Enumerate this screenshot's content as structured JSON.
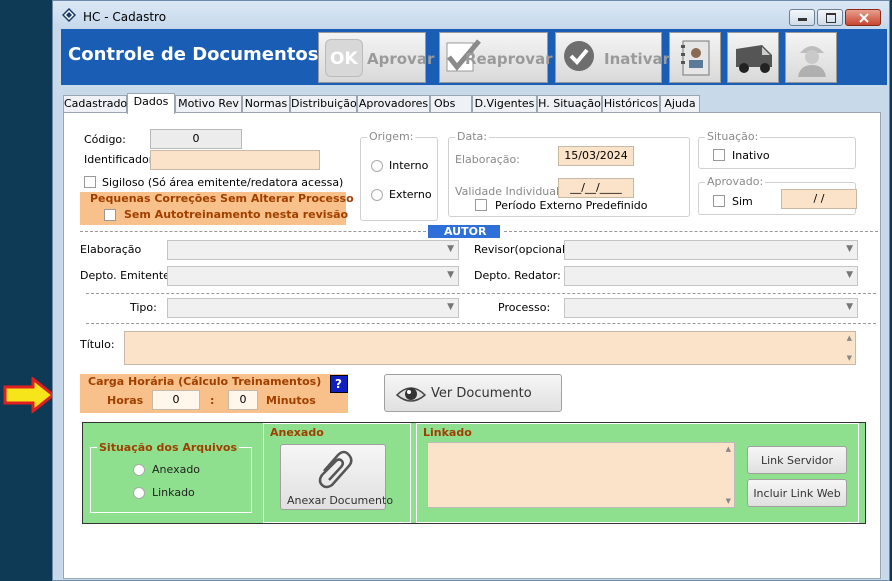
{
  "window": {
    "title": "HC - Cadastro"
  },
  "header": {
    "title": "Controle de Documentos",
    "buttons": {
      "aprovar": "Aprovar",
      "reaprovar": "Reaprovar",
      "inativar": "Inativar"
    },
    "ok_glyph": "OK"
  },
  "tabs": [
    "Cadastrado",
    "Dados",
    "Motivo Rev",
    "Normas",
    "Distribuição",
    "Aprovadores",
    "Obs",
    "D.Vigentes",
    "H. Situação",
    "Históricos",
    "Ajuda"
  ],
  "form": {
    "codigo_label": "Código:",
    "codigo_value": "0",
    "identificador_label": "Identificador:",
    "sigiloso_label": "Sigiloso (Só área emitente/redatora acessa)",
    "pequenas_title": "Pequenas Correções Sem Alterar Processo",
    "sem_autotreinamento": "Sem Autotreinamento nesta revisão",
    "origem_title": "Origem:",
    "interno": "Interno",
    "externo": "Externo",
    "data_title": "Data:",
    "elaboracao_label": "Elaboração:",
    "elaboracao_value": "15/03/2024",
    "validade_label": "Validade Individual:",
    "validade_value": "__/__/____",
    "periodo_externo": "Período Externo Predefinido",
    "situacao_title": "Situação:",
    "inativo": "Inativo",
    "aprovado_title": "Aprovado:",
    "sim": "Sim",
    "aprovado_value": "/ /",
    "autor_band": "AUTOR",
    "elaboracao_combo_label": "Elaboração",
    "revisor_label": "Revisor(opcional)",
    "depto_emitente_label": "Depto. Emitente:",
    "depto_redator_label": "Depto. Redator:",
    "tipo_label": "Tipo:",
    "processo_label": "Processo:",
    "titulo_label": "Título:",
    "carga_title": "Carga Horária (Cálculo Treinamentos)",
    "horas_label": "Horas",
    "horas_value": "0",
    "colon": ":",
    "minutos_value": "0",
    "minutos_label": "Minutos",
    "help_glyph": "?",
    "ver_documento": "Ver Documento"
  },
  "arquivos": {
    "situacao_title": "Situação dos Arquivos",
    "anexado": "Anexado",
    "linkado": "Linkado",
    "anexado_title": "Anexado",
    "anexar_documento": "Anexar Documento",
    "linkado_title": "Linkado",
    "link_servidor": "Link Servidor",
    "incluir_link_web": "Incluir Link Web"
  },
  "colors": {
    "header_blue": "#1a5db5",
    "orange": "#f8c08a",
    "green": "#8ee08e",
    "input_peach": "#fbe3c9",
    "autor_blue": "#2f6fd8"
  }
}
